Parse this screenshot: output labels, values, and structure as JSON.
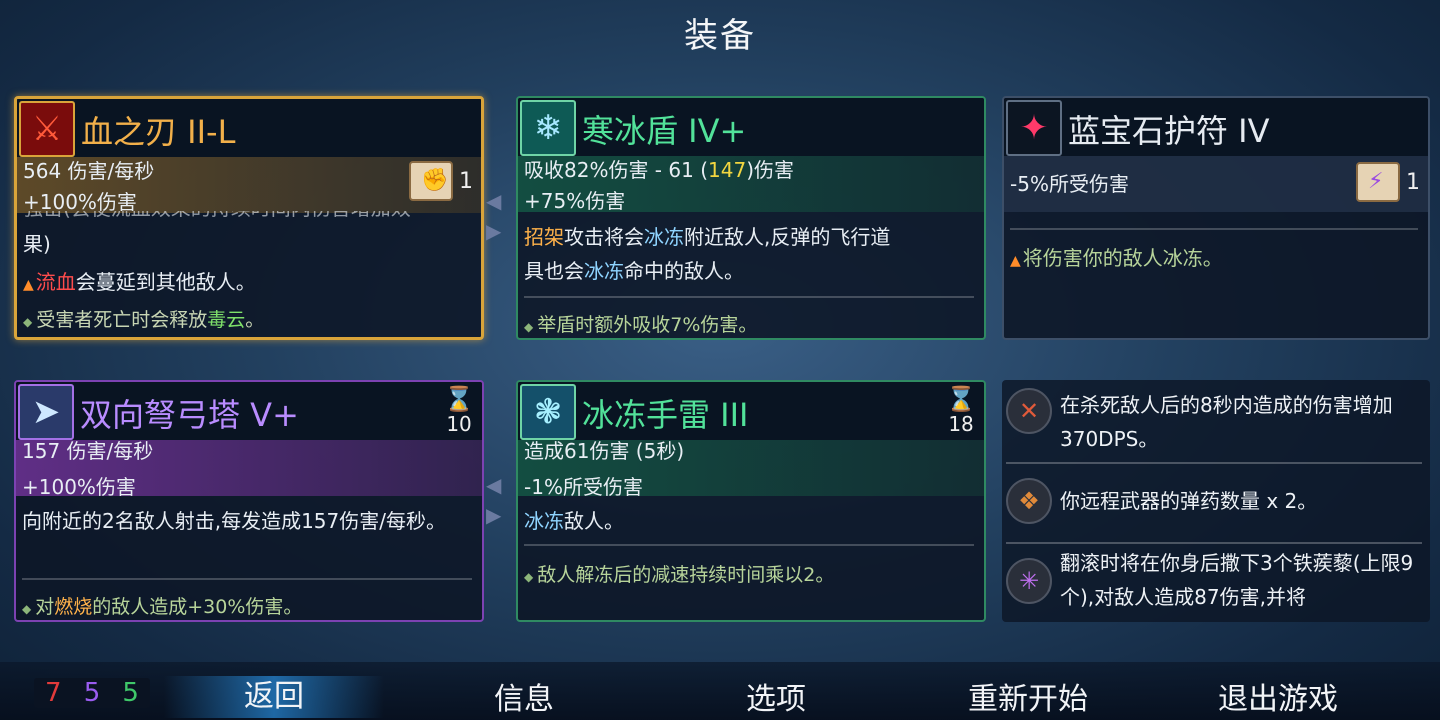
{
  "page_title": "装备",
  "cards": {
    "blade": {
      "title": "血之刃 II-L",
      "icon": "blood-blade-icon",
      "stat1": "564 伤害/每秒",
      "stat2": "+100%伤害",
      "badge_count": "1",
      "badge_icon": "red-fist-scroll-icon",
      "desc_clipped": "强击(会使流血效果的持续时间内伤害增加效",
      "desc_tail": "果)",
      "effect1_hl": "流血",
      "effect1_rest": "会蔓延到其他敌人。",
      "effect2_pre": "受害者死亡时会释放",
      "effect2_hl": "毒云",
      "effect2_post": "。"
    },
    "shield": {
      "title": "寒冰盾 IV+",
      "icon": "ice-shield-icon",
      "stat1_pre": "吸收82%伤害 - 61 (",
      "stat1_hl": "147",
      "stat1_post": ")伤害",
      "stat2": "+75%伤害",
      "desc_hl1": "招架",
      "desc_mid1": "攻击将会",
      "desc_hl2": "冰冻",
      "desc_mid2": "附近敌人,反弹的飞行道",
      "desc_line2_pre": "具也会",
      "desc_hl3": "冰冻",
      "desc_line2_post": "命中的敌人。",
      "note": "举盾时额外吸收7%伤害。"
    },
    "amulet": {
      "title": "蓝宝石护符 IV",
      "icon": "sapphire-amulet-icon",
      "stat1": "-5%所受伤害",
      "badge_count": "1",
      "badge_icon": "purple-lightning-scroll-icon",
      "effect": "将伤害你的敌人冰冻。"
    },
    "turret": {
      "title": "双向弩弓塔 V+",
      "icon": "crossbow-turret-icon",
      "timer": "10",
      "stat1": "157 伤害/每秒",
      "stat2": "+100%伤害",
      "desc": "向附近的2名敌人射击,每发造成157伤害/每秒。",
      "note_pre": "对",
      "note_hl": "燃烧",
      "note_post": "的敌人造成+30%伤害。"
    },
    "grenade": {
      "title": "冰冻手雷 III",
      "icon": "ice-grenade-icon",
      "timer": "18",
      "stat1": "造成61伤害 (5秒)",
      "stat2": "-1%所受伤害",
      "desc_hl": "冰冻",
      "desc_post": "敌人。",
      "note": "敌人解冻后的减速持续时间乘以2。"
    }
  },
  "mutations": [
    {
      "icon": "bow-kill-icon",
      "text": "在杀死敌人后的8秒内造成的伤害增加370DPS。"
    },
    {
      "icon": "ammo-quiver-icon",
      "text": "你远程武器的弹药数量 x 2。"
    },
    {
      "icon": "caltrops-icon",
      "text": "翻滚时将在你身后撒下3个铁蒺藜(上限9个),对敌人造成87伤害,并将"
    }
  ],
  "scrolls": {
    "brutality": "7",
    "tactics": "5",
    "survival": "5"
  },
  "colors": {
    "brutality": "#e23b3b",
    "tactics": "#9a5cf0",
    "survival": "#3fc86a"
  },
  "menu": {
    "back": "返回",
    "info": "信息",
    "options": "选项",
    "restart": "重新开始",
    "quit": "退出游戏"
  }
}
